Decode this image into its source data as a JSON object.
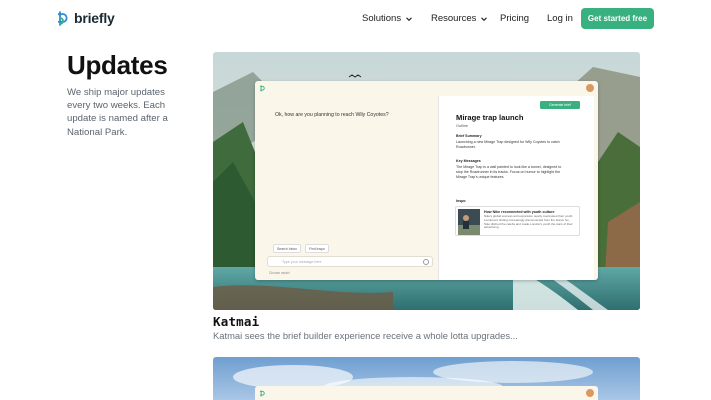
{
  "nav": {
    "brand": "briefly",
    "items": [
      {
        "label": "Solutions",
        "has_dropdown": true
      },
      {
        "label": "Resources",
        "has_dropdown": true
      },
      {
        "label": "Pricing",
        "has_dropdown": false
      },
      {
        "label": "Log in",
        "has_dropdown": false
      }
    ],
    "cta": "Get started free"
  },
  "page": {
    "title": "Updates",
    "intro": "We ship major updates every two weeks. Each update is named after a National Park."
  },
  "posts": [
    {
      "title": "Katmai",
      "description": "Katmai sees the brief builder experience receive a whole lotta upgrades...",
      "mockup": {
        "question": "Ok, how are you planning to reach Wily Coyotes?",
        "chips": [
          "Search Inbox",
          "Find Inspo"
        ],
        "input_placeholder": "Type your message here",
        "model_label": "Choose model",
        "generate_button": "Generate brief",
        "panel_title": "Mirage trap launch",
        "panel_subtitle": "Outline",
        "sections": [
          {
            "heading": "Brief Summary",
            "body": "Launching a new Mirage Trap designed for Wily Coyotes to catch Roadrunner."
          },
          {
            "heading": "Key Messages",
            "body": "The Mirage Trap is a wall painted to look like a tunnel, designed to stop the Roadrunner in its tracks. Focus on humor to highlight the Mirage Trap's unique features."
          },
          {
            "heading": "Inspo",
            "body": ""
          }
        ],
        "inspo": {
          "title": "How Nike reconnected with youth culture",
          "body": "Nike's global success and expansion nearly overlooked their youth. Londoners finding increasingly disconnected from the brand. So, Nike ditched the celebs and made London's youth the stars of their advertising."
        }
      }
    }
  ],
  "colors": {
    "accent": "#39b07f",
    "text": "#1d1d1f",
    "muted": "#5a6470"
  }
}
